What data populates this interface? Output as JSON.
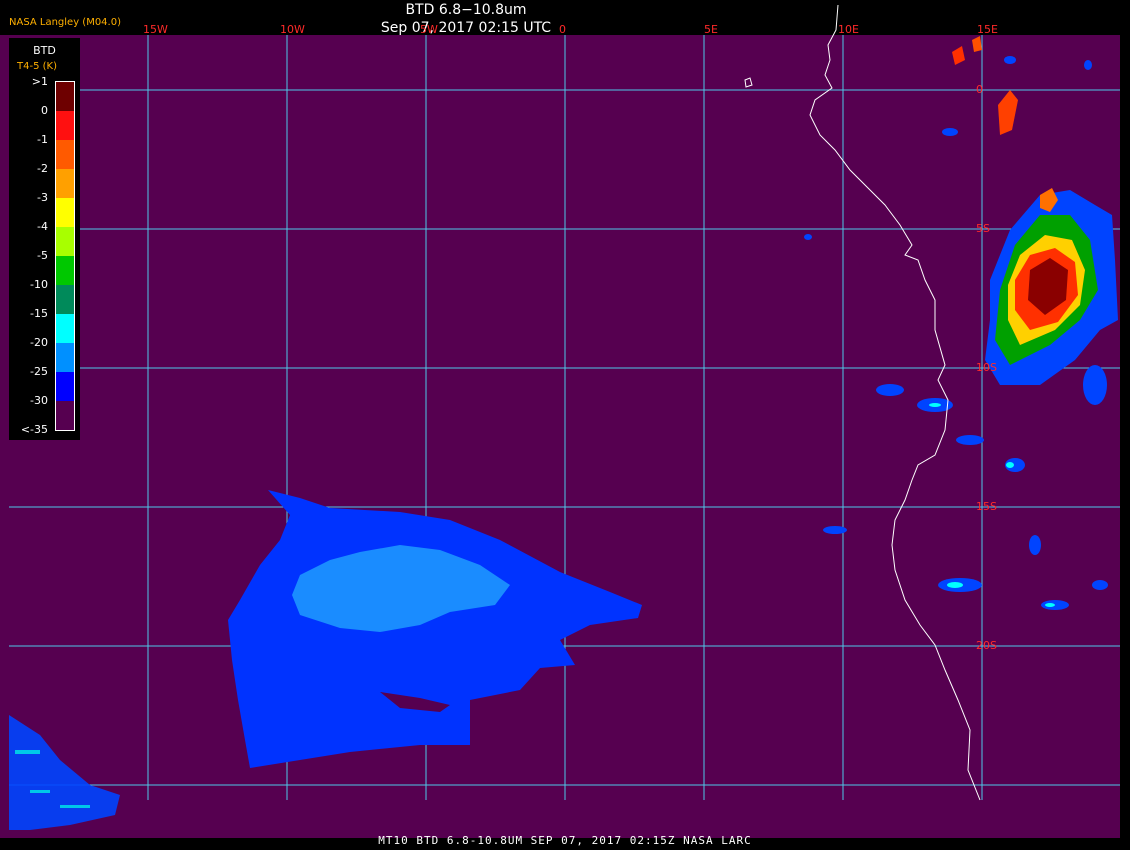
{
  "header": {
    "title": "BTD 6.8−10.8um",
    "timestamp": "Sep 07, 2017 02:15 UTC",
    "credit": "NASA Langley (M04.0)"
  },
  "footer": "MT10  BTD 6.8-10.8UM  SEP 07, 2017 02:15Z  NASA LARC",
  "legend": {
    "title": "BTD",
    "subtitle": "T4-5 (K)",
    "ticks": [
      ">1",
      "0",
      "-1",
      "-2",
      "-3",
      "-4",
      "-5",
      "-10",
      "-15",
      "-20",
      "-25",
      "-30",
      "<-35"
    ],
    "colors": [
      "#6e0000",
      "#ff1010",
      "#ff5a00",
      "#ffa000",
      "#ffff00",
      "#a8ff00",
      "#00c800",
      "#008a5a",
      "#00ffff",
      "#0090ff",
      "#0000ff",
      "#560050"
    ]
  },
  "grid": {
    "lon_labels": [
      "15W",
      "10W",
      "5W",
      "0",
      "5E",
      "10E",
      "15E"
    ],
    "lat_labels": [
      "0",
      "5S",
      "10S",
      "15S",
      "20S"
    ]
  },
  "colors": {
    "background": "#560050",
    "gridline": "#4ec8e8",
    "coastline": "#ffffff",
    "label": "#ff2a2a",
    "plume_dark": "#0033ff",
    "plume_light": "#1a8cff"
  }
}
